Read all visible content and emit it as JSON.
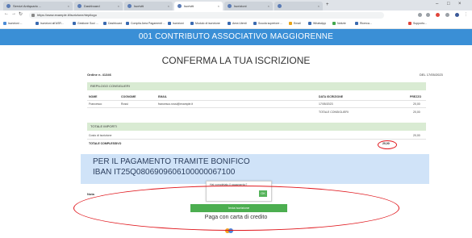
{
  "browser": {
    "tabs": [
      {
        "label": "Servizi Antiquario ..."
      },
      {
        "label": "Dashboard"
      },
      {
        "label": "Iscriviti"
      },
      {
        "label": "Iscriviti"
      },
      {
        "label": "Iscrizioni"
      },
      {
        "label": ""
      }
    ],
    "url": "https://www.example.it/iscrizione/riepilogo",
    "bookmarks": [
      {
        "label": "Iscrizioni ..."
      },
      {
        "label": "Iscrizioni all'ASR..."
      },
      {
        "label": "Gestione Soci ..."
      },
      {
        "label": "Dashboard"
      },
      {
        "label": "Compila Area Pagamenti ..."
      },
      {
        "label": "Iscrizioni"
      },
      {
        "label": "Modulo di iscrizione"
      },
      {
        "label": "Area Utenti"
      },
      {
        "label": "Scuola superiore ..."
      },
      {
        "label": "Email"
      },
      {
        "label": "WhatsApp"
      },
      {
        "label": "Notizie"
      },
      {
        "label": "Ricerca..."
      },
      {
        "label": "Supporto..."
      }
    ]
  },
  "header": {
    "title": "001 CONTRIBUTO ASSOCIATIVO MAGGIORENNE"
  },
  "page": {
    "title": "CONFERMA LA TUA ISCRIZIONE",
    "order_number": "Ordine n. 41346",
    "order_date": "DEL 17/05/2023"
  },
  "summary": {
    "heading": "RIEPILOGO CONSIGLIERI",
    "columns": {
      "nome": "NOME",
      "cognome": "COGNOME",
      "email": "EMAIL",
      "data": "DATA ISCRIZIONE",
      "prezzo": "PREZZO"
    },
    "row": {
      "nome": "Francesco",
      "cognome": "Rossi",
      "email": "francesco.rossi@example.it",
      "data": "17/05/2023",
      "prezzo": "20,00"
    },
    "totale_label": "TOTALE CONSIGLIERI",
    "totale_value": "20,00"
  },
  "totals": {
    "heading": "TOTALE IMPORTI",
    "rows": [
      {
        "label": "Costo di iscrizione",
        "value": "20,00"
      },
      {
        "label": "TOTALE COMPLESSIVO",
        "value": "20,00"
      }
    ]
  },
  "payment": {
    "line1": "PER IL PAGAMENTO TRAMITE BONIFICO",
    "line2": "IBAN  IT25Q0806909606100000067100",
    "notice": "Nota"
  },
  "popup": {
    "text": "Hai completato il pagamento?",
    "button": "OK"
  },
  "actions": {
    "primary": "Invia iscrizione",
    "card_text": "Paga con carta di credito"
  },
  "colors": {
    "header_bg": "#3a8fd6",
    "group_header_bg": "#d9ebd3",
    "pay_block_bg": "#d0e3f8",
    "primary_button": "#4cae50",
    "annotation_red": "#e0161c"
  }
}
